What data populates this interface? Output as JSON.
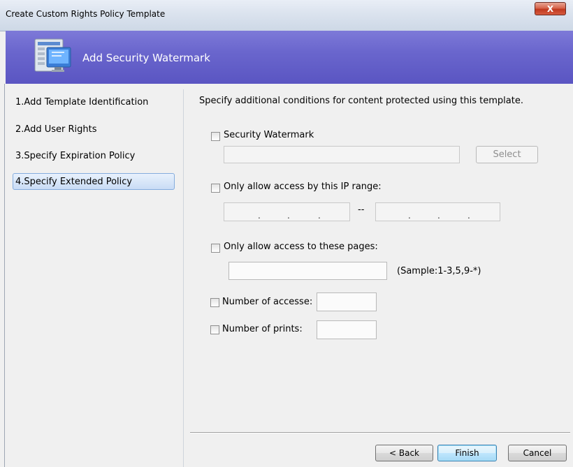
{
  "window": {
    "title": "Create Custom Rights Policy Template",
    "close_glyph": "X"
  },
  "banner": {
    "title": "Add Security Watermark",
    "icon": "computer-window-icon"
  },
  "nav": {
    "items": [
      {
        "label": "1.Add Template Identification"
      },
      {
        "label": "2.Add User Rights"
      },
      {
        "label": "3.Specify Expiration Policy"
      },
      {
        "label": "4.Specify Extended Policy",
        "active": true
      }
    ]
  },
  "content": {
    "description": "Specify additional conditions for content protected using this template.",
    "watermark": {
      "label": "Security Watermark",
      "checked": false,
      "value": "",
      "select_label": "Select"
    },
    "ip_range": {
      "label": "Only allow access by this IP range:",
      "checked": false,
      "separator": "--",
      "from_dots": ". . .",
      "to_dots": ". . ."
    },
    "pages": {
      "label": "Only allow access to these pages:",
      "checked": false,
      "value": "",
      "sample": "(Sample:1-3,5,9-*)"
    },
    "accesses": {
      "label": "Number of accesse:",
      "checked": false,
      "value": ""
    },
    "prints": {
      "label": "Number of prints:",
      "checked": false,
      "value": ""
    }
  },
  "footer": {
    "back_label": "< Back",
    "finish_label": "Finish",
    "cancel_label": "Cancel"
  },
  "colors": {
    "banner": "#6a66cd",
    "active_nav": "#c9dcf5",
    "close": "#c9442b"
  }
}
